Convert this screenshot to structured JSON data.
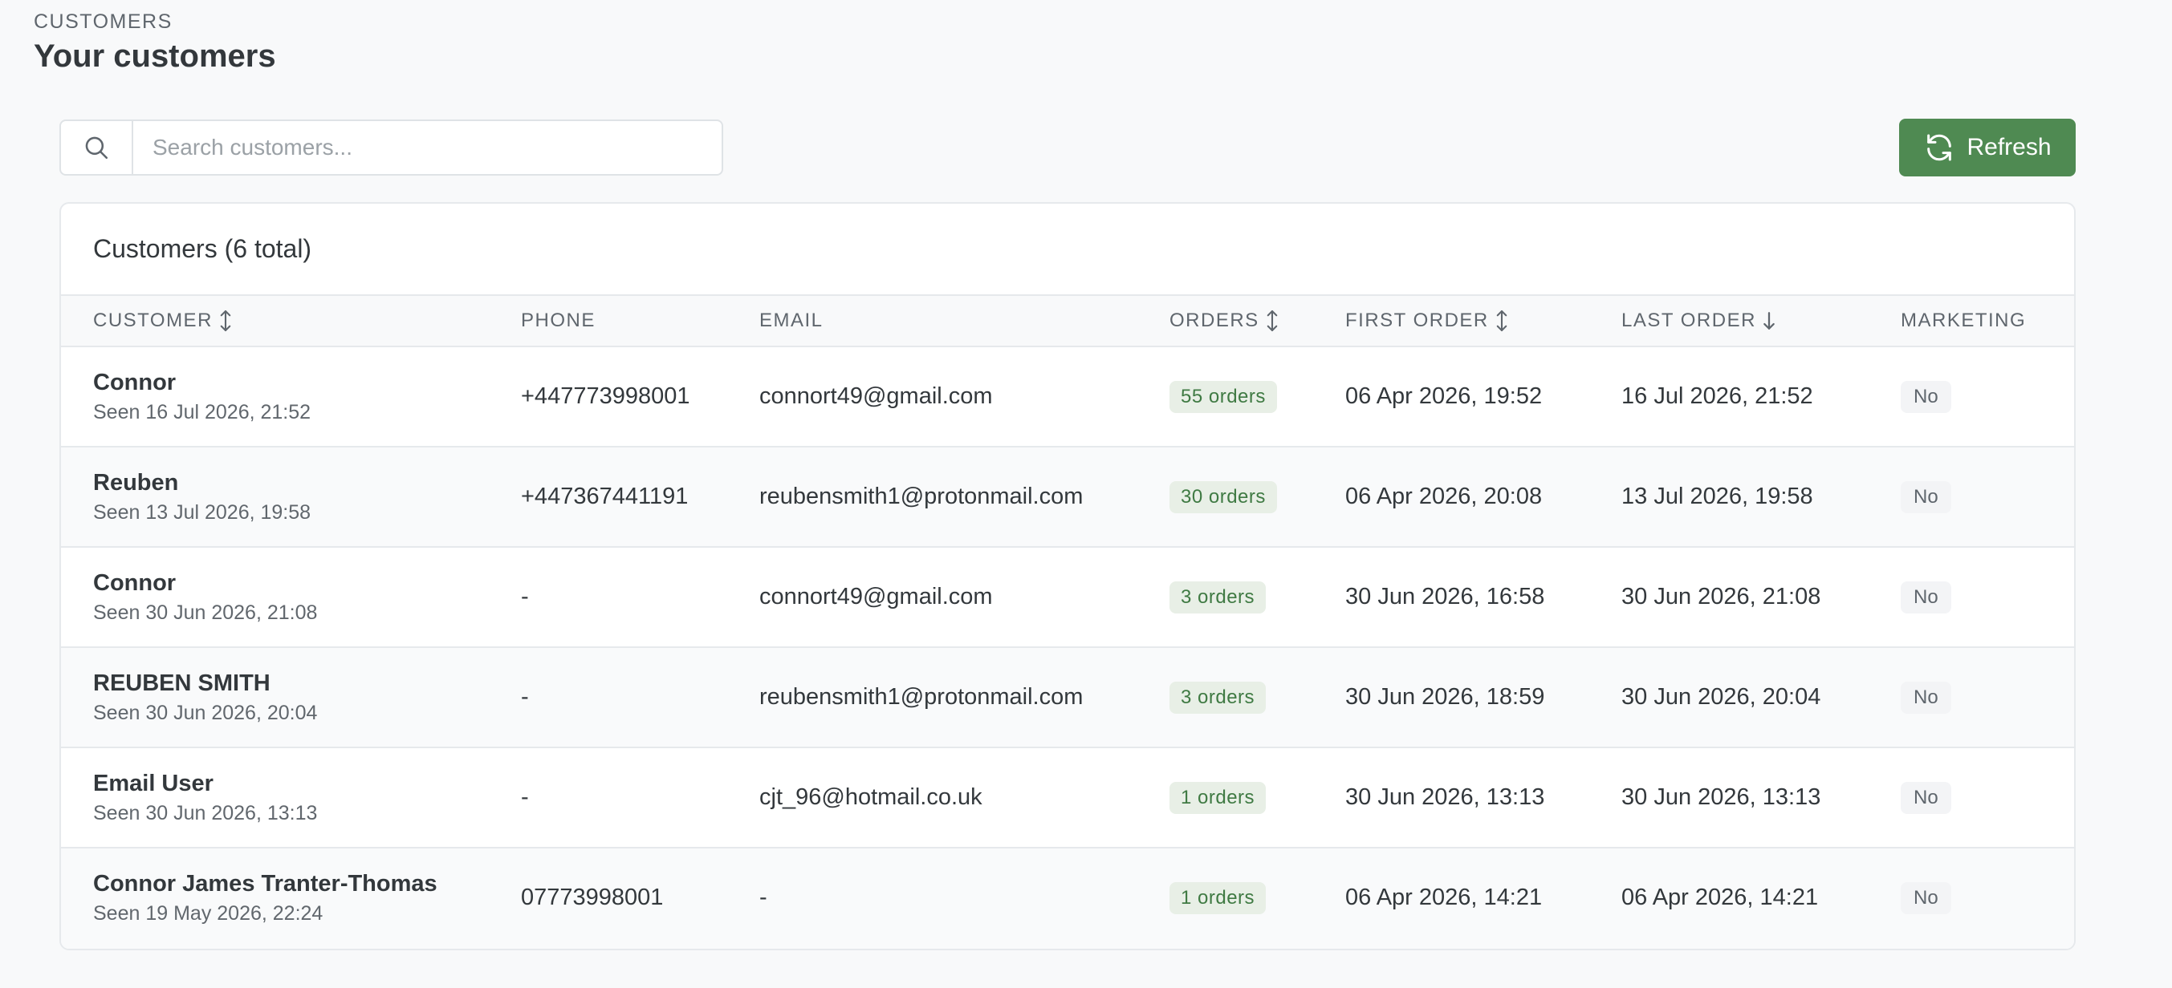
{
  "header": {
    "eyebrow": "CUSTOMERS",
    "title": "Your customers"
  },
  "search": {
    "placeholder": "Search customers...",
    "value": "",
    "icon": "search-icon"
  },
  "toolbar": {
    "refresh_label": "Refresh",
    "refresh_icon": "refresh-icon",
    "accent_color": "#4f8a52"
  },
  "table": {
    "title": "Customers (6 total)",
    "columns": [
      {
        "label": "CUSTOMER",
        "sort": "sortable"
      },
      {
        "label": "PHONE",
        "sort": "none"
      },
      {
        "label": "EMAIL",
        "sort": "none"
      },
      {
        "label": "ORDERS",
        "sort": "sortable"
      },
      {
        "label": "FIRST ORDER",
        "sort": "sortable"
      },
      {
        "label": "LAST ORDER",
        "sort": "descending"
      },
      {
        "label": "MARKETING",
        "sort": "none"
      }
    ],
    "rows": [
      {
        "name": "Connor",
        "seen": "Seen 16 Jul 2026, 21:52",
        "phone": "+447773998001",
        "email": "connort49@gmail.com",
        "orders": "55 orders",
        "first_order": "06 Apr 2026, 19:52",
        "last_order": "16 Jul 2026, 21:52",
        "marketing": "No"
      },
      {
        "name": "Reuben",
        "seen": "Seen 13 Jul 2026, 19:58",
        "phone": "+447367441191",
        "email": "reubensmith1@protonmail.com",
        "orders": "30 orders",
        "first_order": "06 Apr 2026, 20:08",
        "last_order": "13 Jul 2026, 19:58",
        "marketing": "No"
      },
      {
        "name": "Connor",
        "seen": "Seen 30 Jun 2026, 21:08",
        "phone": "-",
        "email": "connort49@gmail.com",
        "orders": "3 orders",
        "first_order": "30 Jun 2026, 16:58",
        "last_order": "30 Jun 2026, 21:08",
        "marketing": "No"
      },
      {
        "name": "REUBEN SMITH",
        "seen": "Seen 30 Jun 2026, 20:04",
        "phone": "-",
        "email": "reubensmith1@protonmail.com",
        "orders": "3 orders",
        "first_order": "30 Jun 2026, 18:59",
        "last_order": "30 Jun 2026, 20:04",
        "marketing": "No"
      },
      {
        "name": "Email User",
        "seen": "Seen 30 Jun 2026, 13:13",
        "phone": "-",
        "email": "cjt_96@hotmail.co.uk",
        "orders": "1 orders",
        "first_order": "30 Jun 2026, 13:13",
        "last_order": "30 Jun 2026, 13:13",
        "marketing": "No"
      },
      {
        "name": "Connor James Tranter-Thomas",
        "seen": "Seen 19 May 2026, 22:24",
        "phone": "07773998001",
        "email": "-",
        "orders": "1 orders",
        "first_order": "06 Apr 2026, 14:21",
        "last_order": "06 Apr 2026, 14:21",
        "marketing": "No"
      }
    ]
  }
}
